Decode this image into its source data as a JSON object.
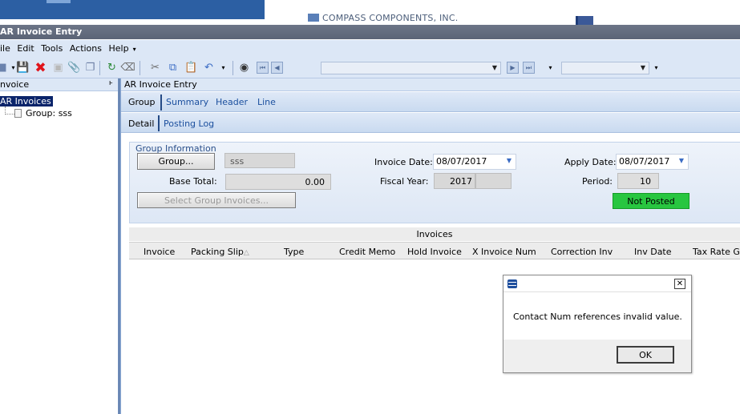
{
  "topbar": {
    "company": "COMPASS COMPONENTS, INC."
  },
  "window": {
    "title": "AR Invoice Entry"
  },
  "menu": {
    "items": [
      "ile",
      "Edit",
      "Tools",
      "Actions",
      "Help"
    ]
  },
  "tree": {
    "header": "nvoice",
    "pin": "ͱ",
    "root": "AR Invoices",
    "child": "Group: sss"
  },
  "main": {
    "header": "AR Invoice Entry",
    "tabs": [
      "Group",
      "Summary",
      "Header",
      "Line"
    ],
    "subtabs": [
      "Detail",
      "Posting Log"
    ]
  },
  "group_info": {
    "caption": "Group Information",
    "group_button": "Group...",
    "group_value": "sss",
    "base_total_label": "Base Total:",
    "base_total_value": "0.00",
    "select_button": "Select Group Invoices...",
    "invoice_date_label": "Invoice Date:",
    "invoice_date_value": "08/07/2017",
    "fiscal_year_label": "Fiscal Year:",
    "fiscal_year_value": "2017",
    "apply_date_label": "Apply Date:",
    "apply_date_value": "08/07/2017",
    "period_label": "Period:",
    "period_value": "10",
    "status": "Not Posted"
  },
  "grid": {
    "caption": "Invoices",
    "columns": [
      "Invoice",
      "Packing Slip",
      "Type",
      "Credit Memo",
      "Hold Invoice",
      "X Invoice Num",
      "Correction Inv",
      "Inv Date",
      "Tax Rate G"
    ]
  },
  "dialog": {
    "close": "✕",
    "message": "Contact Num references invalid value.",
    "ok": "OK"
  },
  "colors": {
    "title_bar": "#5f6879",
    "toolbar": "#dce7f6",
    "tab_text": "#1b4f9e",
    "status_green": "#28c640"
  }
}
